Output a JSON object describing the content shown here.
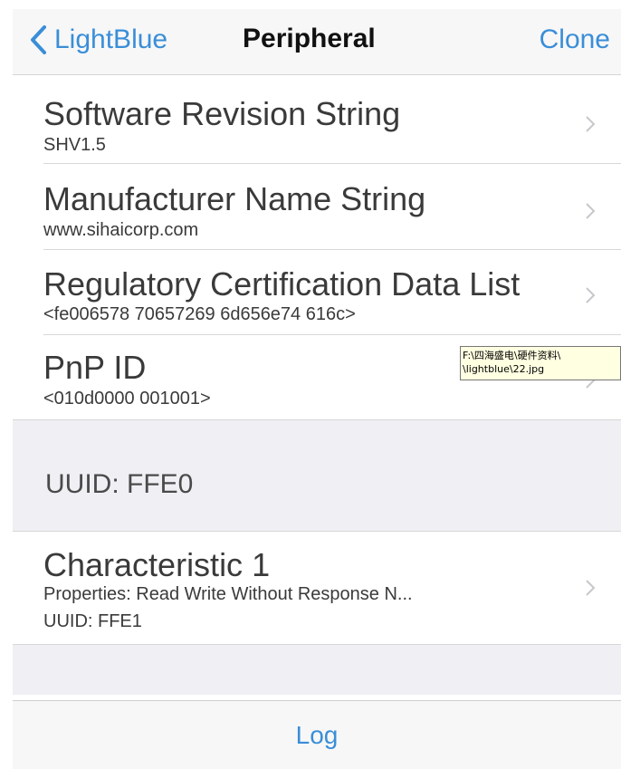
{
  "colors": {
    "accent": "#3a8ed8",
    "nav_background": "#f7f7f7",
    "group_background": "#efeff4",
    "tooltip_background": "#ffffe1"
  },
  "navbar": {
    "back_icon": "chevron-left-icon",
    "back_label": "LightBlue",
    "title": "Peripheral",
    "right_label": "Clone"
  },
  "rows": [
    {
      "title": "Software Revision String",
      "subtitle": "SHV1.5",
      "icon": "chevron-right-icon"
    },
    {
      "title": "Manufacturer Name String",
      "subtitle": "www.sihaicorp.com",
      "icon": "chevron-right-icon"
    },
    {
      "title": "Regulatory Certification Data List",
      "subtitle": "<fe006578 70657269 6d656e74 616c>",
      "icon": "chevron-right-icon"
    },
    {
      "title": "PnP ID",
      "subtitle": "<010d0000 001001>",
      "icon": "chevron-right-icon"
    }
  ],
  "service_header": "UUID: FFE0",
  "characteristic": {
    "title": "Characteristic 1",
    "properties": "Properties: Read Write Without Response N...",
    "uuid": "UUID: FFE1",
    "icon": "chevron-right-icon"
  },
  "toolbar": {
    "log_label": "Log"
  },
  "tooltip": {
    "line1": "F:\\四海盛电\\硬件资料\\",
    "line2": "\\lightblue\\22.jpg"
  }
}
